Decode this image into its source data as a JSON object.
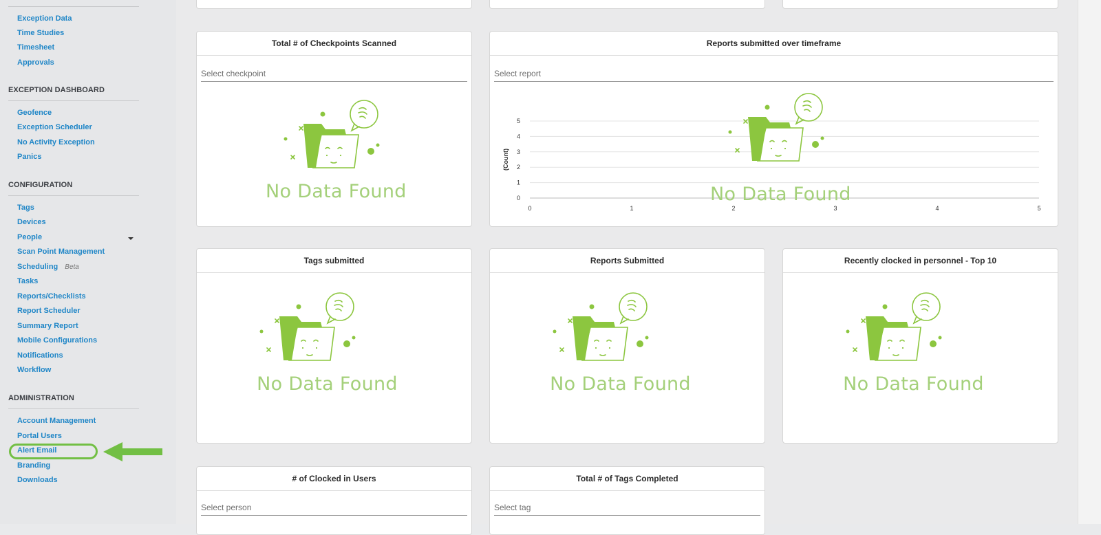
{
  "sidebar": {
    "top_items": [
      "Exception Data",
      "Time Studies",
      "Timesheet",
      "Approvals"
    ],
    "sections": [
      {
        "heading": "EXCEPTION DASHBOARD",
        "items": [
          "Geofence",
          "Exception Scheduler",
          "No Activity Exception",
          "Panics"
        ]
      },
      {
        "heading": "CONFIGURATION",
        "items": [
          "Tags",
          "Devices",
          "People",
          "Scan Point Management",
          "Scheduling",
          "Tasks",
          "Reports/Checklists",
          "Report Scheduler",
          "Summary Report",
          "Mobile Configurations",
          "Notifications",
          "Workflow"
        ],
        "beta_label": "Beta"
      },
      {
        "heading": "ADMINISTRATION",
        "items": [
          "Account Management",
          "Portal Users",
          "Alert Email",
          "Branding",
          "Downloads"
        ]
      }
    ],
    "highlighted_item": "Alert Email",
    "accent_color": "#72bf44"
  },
  "cards": {
    "checkpoints": {
      "title": "Total # of Checkpoints Scanned",
      "placeholder": "Select checkpoint",
      "empty": "No Data Found"
    },
    "reports_timeframe": {
      "title": "Reports submitted over timeframe",
      "placeholder": "Select report",
      "empty": "No Data Found",
      "ylabel": "(Count)"
    },
    "tags_submitted": {
      "title": "Tags submitted",
      "empty": "No Data Found"
    },
    "reports_submitted": {
      "title": "Reports Submitted",
      "empty": "No Data Found"
    },
    "recent_personnel": {
      "title": "Recently clocked in personnel - Top 10",
      "empty": "No Data Found"
    },
    "clocked_users": {
      "title": "# of Clocked in Users",
      "placeholder": "Select person"
    },
    "tags_completed": {
      "title": "Total # of Tags Completed",
      "placeholder": "Select tag"
    }
  },
  "chart_data": {
    "type": "line",
    "ylabel": "(Count)",
    "xlabel": "",
    "x_ticks": [
      "0",
      "1",
      "2",
      "3",
      "4",
      "5"
    ],
    "y_ticks": [
      "0",
      "1",
      "2",
      "3",
      "4",
      "5"
    ],
    "xlim": [
      0,
      5
    ],
    "ylim": [
      0,
      5
    ],
    "grid": true,
    "series": []
  },
  "colors": {
    "link": "#1f86c7",
    "empty_state": "#8cc63f"
  }
}
